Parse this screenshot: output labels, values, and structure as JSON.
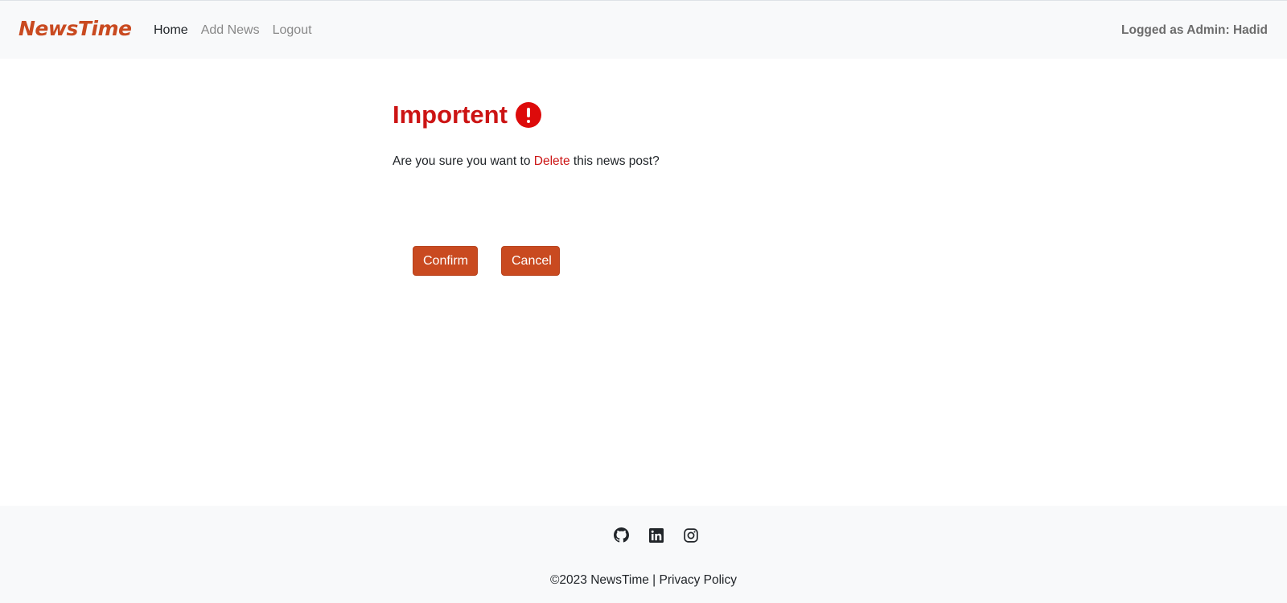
{
  "brand": {
    "name": "NewsTime",
    "color": "#c94a20"
  },
  "nav": {
    "items": [
      {
        "label": "Home",
        "active": true
      },
      {
        "label": "Add News",
        "active": false
      },
      {
        "label": "Logout",
        "active": false
      }
    ],
    "user_label": "Logged as Admin: Hadid"
  },
  "dialog": {
    "title": "Importent",
    "icon": "exclamation-circle-icon",
    "question_before": "Are you sure you want to ",
    "question_action": "Delete",
    "question_after": " this news post?",
    "confirm_label": "Confirm",
    "cancel_label": "Cancel",
    "danger_color": "#cc1414"
  },
  "footer": {
    "socials": [
      "github-icon",
      "linkedin-icon",
      "instagram-icon"
    ],
    "copyright": "©2023 NewsTime |",
    "privacy_label": "Privacy Policy"
  }
}
